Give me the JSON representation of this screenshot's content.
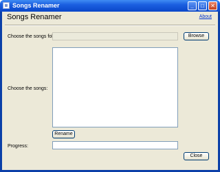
{
  "window": {
    "title": "Songs Renamer",
    "minimize_glyph": "_",
    "maximize_glyph": "□",
    "close_glyph": "✕"
  },
  "header": {
    "heading": "Songs Renamer",
    "about_link": "About"
  },
  "form": {
    "folder_label": "Choose the songs folder:",
    "folder_value": "",
    "browse_label": "Browse",
    "songs_label": "Choose the songs:",
    "songs_items": [],
    "rename_label": "Rename",
    "progress_label": "Progress:",
    "progress_value": "",
    "close_label": "Close"
  },
  "icons": [
    "app-icon",
    "minimize-icon",
    "maximize-icon",
    "close-icon"
  ]
}
